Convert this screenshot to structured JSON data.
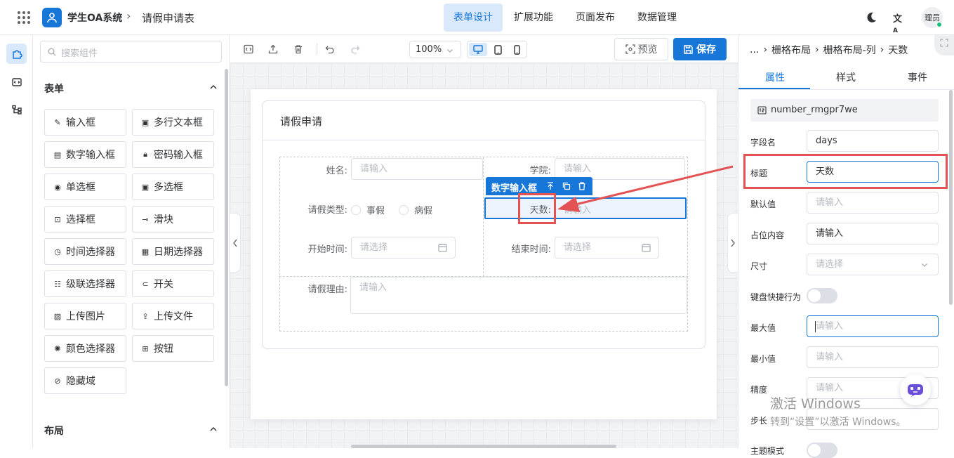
{
  "app": {
    "title": "学生OA系统",
    "breadcrumb_sep": "›",
    "form_name": "请假申请表"
  },
  "nav_tabs": [
    {
      "label": "表单设计",
      "active": true
    },
    {
      "label": "扩展功能",
      "active": false
    },
    {
      "label": "页面发布",
      "active": false
    },
    {
      "label": "数据管理",
      "active": false
    }
  ],
  "user": {
    "avatar_text": "理员"
  },
  "palette": {
    "search_placeholder": "搜索组件",
    "form_section": "表单",
    "layout_section": "布局",
    "form_items": [
      {
        "label": "输入框",
        "icon": "edit-icon"
      },
      {
        "label": "多行文本框",
        "icon": "textarea-icon"
      },
      {
        "label": "数字输入框",
        "icon": "number-icon"
      },
      {
        "label": "密码输入框",
        "icon": "lock-icon"
      },
      {
        "label": "单选框",
        "icon": "radio-icon"
      },
      {
        "label": "多选框",
        "icon": "checkbox-icon"
      },
      {
        "label": "选择框",
        "icon": "select-icon"
      },
      {
        "label": "滑块",
        "icon": "slider-icon"
      },
      {
        "label": "时间选择器",
        "icon": "clock-icon"
      },
      {
        "label": "日期选择器",
        "icon": "calendar-icon"
      },
      {
        "label": "级联选择器",
        "icon": "cascader-icon"
      },
      {
        "label": "开关",
        "icon": "switch-icon"
      },
      {
        "label": "上传图片",
        "icon": "image-icon"
      },
      {
        "label": "上传文件",
        "icon": "upload-icon"
      },
      {
        "label": "颜色选择器",
        "icon": "palette-icon"
      },
      {
        "label": "按钮",
        "icon": "button-icon"
      },
      {
        "label": "隐藏域",
        "icon": "eye-off-icon"
      }
    ]
  },
  "toolbar": {
    "zoom": "100%",
    "preview_label": "预览",
    "save_label": "保存"
  },
  "form": {
    "title": "请假申请",
    "fields": {
      "name_label": "姓名:",
      "name_placeholder": "请输入",
      "college_label": "学院:",
      "college_placeholder": "请输入",
      "type_label": "请假类型:",
      "type_options": [
        "事假",
        "病假"
      ],
      "days_label": "天数:",
      "days_placeholder": "请输入",
      "start_label": "开始时间:",
      "start_placeholder": "请选择",
      "end_label": "结束时间:",
      "end_placeholder": "请选择",
      "reason_label": "请假理由:",
      "reason_placeholder": "请输入"
    },
    "selected_tag": "数字输入框"
  },
  "props_panel": {
    "breadcrumb": [
      "...",
      "栅格布局",
      "栅格布局-列",
      "天数"
    ],
    "tabs": [
      "属性",
      "样式",
      "事件"
    ],
    "active_tab": 0,
    "component_id": "number_rmgpr7we",
    "rows": [
      {
        "label": "字段名",
        "value": "days",
        "placeholder": ""
      },
      {
        "label": "标题",
        "value": "天数",
        "placeholder": ""
      },
      {
        "label": "默认值",
        "value": "",
        "placeholder": "请输入"
      },
      {
        "label": "占位内容",
        "value": "请输入",
        "placeholder": ""
      },
      {
        "label": "尺寸",
        "value": "",
        "placeholder": "请选择"
      },
      {
        "label": "键盘快捷行为",
        "value": "",
        "placeholder": ""
      },
      {
        "label": "最大值",
        "value": "",
        "placeholder": "请输入"
      },
      {
        "label": "最小值",
        "value": "",
        "placeholder": "请输入"
      },
      {
        "label": "精度",
        "value": "",
        "placeholder": "请输入"
      },
      {
        "label": "步长",
        "value": "",
        "placeholder": ""
      },
      {
        "label": "主题模式",
        "value": "",
        "placeholder": ""
      }
    ]
  },
  "watermark": {
    "line1": "激活 Windows",
    "line2": "转到“设置”以激活 Windows。"
  },
  "colors": {
    "primary": "#1677d8",
    "highlight_red": "#e45353",
    "tab_active_bg": "#d9e8fa"
  }
}
